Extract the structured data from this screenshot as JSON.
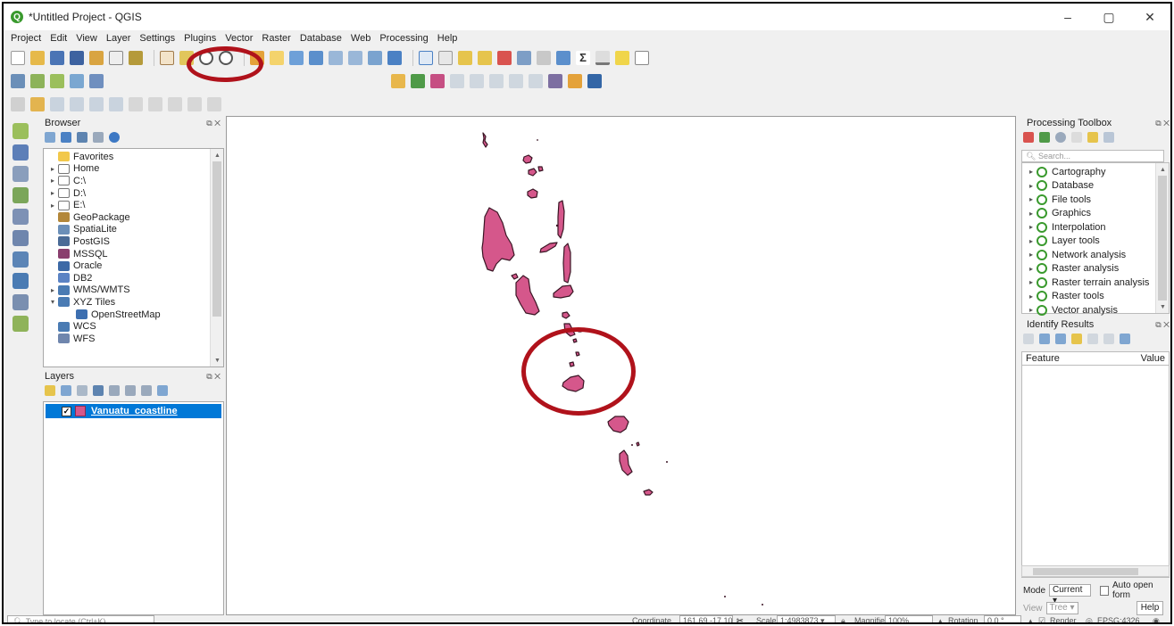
{
  "window": {
    "title": "*Untitled Project - QGIS",
    "app_icon": "qgis-logo",
    "controls": [
      "–",
      "▢",
      "✕"
    ]
  },
  "menu": [
    "Project",
    "Edit",
    "View",
    "Layer",
    "Settings",
    "Plugins",
    "Vector",
    "Raster",
    "Database",
    "Web",
    "Processing",
    "Help"
  ],
  "browser": {
    "title": "Browser",
    "items": [
      {
        "label": "Favorites",
        "icon": "star-icon",
        "expand": ""
      },
      {
        "label": "Home",
        "icon": "home-icon",
        "expand": "▸"
      },
      {
        "label": "C:\\",
        "icon": "drive-icon",
        "expand": "▸"
      },
      {
        "label": "D:\\",
        "icon": "drive-icon",
        "expand": "▸"
      },
      {
        "label": "E:\\",
        "icon": "drive-icon",
        "expand": "▸"
      },
      {
        "label": "GeoPackage",
        "icon": "geopackage-icon",
        "expand": ""
      },
      {
        "label": "SpatiaLite",
        "icon": "spatialite-icon",
        "expand": ""
      },
      {
        "label": "PostGIS",
        "icon": "postgis-icon",
        "expand": ""
      },
      {
        "label": "MSSQL",
        "icon": "mssql-icon",
        "expand": ""
      },
      {
        "label": "Oracle",
        "icon": "oracle-icon",
        "expand": ""
      },
      {
        "label": "DB2",
        "icon": "db2-icon",
        "expand": ""
      },
      {
        "label": "WMS/WMTS",
        "icon": "wms-icon",
        "expand": "▸"
      },
      {
        "label": "XYZ Tiles",
        "icon": "xyz-icon",
        "expand": "▾"
      },
      {
        "label": "OpenStreetMap",
        "icon": "osm-icon",
        "expand": "",
        "indent": true
      },
      {
        "label": "WCS",
        "icon": "wcs-icon",
        "expand": ""
      },
      {
        "label": "WFS",
        "icon": "wfs-icon",
        "expand": ""
      }
    ]
  },
  "layers": {
    "title": "Layers",
    "items": [
      {
        "name": "Vanuatu_coastline",
        "checked": true,
        "fill": "#d5578b"
      }
    ]
  },
  "processing": {
    "title": "Processing Toolbox",
    "search_placeholder": "Search...",
    "groups": [
      "Cartography",
      "Database",
      "File tools",
      "Graphics",
      "Interpolation",
      "Layer tools",
      "Network analysis",
      "Raster analysis",
      "Raster terrain analysis",
      "Raster tools",
      "Vector analysis"
    ]
  },
  "identify": {
    "title": "Identify Results",
    "col_feature": "Feature",
    "col_value": "Value",
    "mode_label": "Mode",
    "mode_value": "Current",
    "auto_open": "Auto open form",
    "view_label": "View",
    "view_value": "Tree",
    "help_label": "Help"
  },
  "status": {
    "locate_placeholder": "Type to locate (Ctrl+K)",
    "coordinate_label": "Coordinate",
    "coordinate_value": "161.69,-17.10",
    "scale_label": "Scale",
    "scale_value": "1:4983873",
    "magnifier_label": "Magnifier",
    "magnifier_value": "100%",
    "rotation_label": "Rotation",
    "rotation_value": "0.0 °",
    "render_label": "Render",
    "crs": "EPSG:4326"
  },
  "colors": {
    "island_fill": "#d5578b",
    "island_stroke": "#3a1524",
    "highlight": "#b0121b",
    "selection": "#0078d7"
  }
}
